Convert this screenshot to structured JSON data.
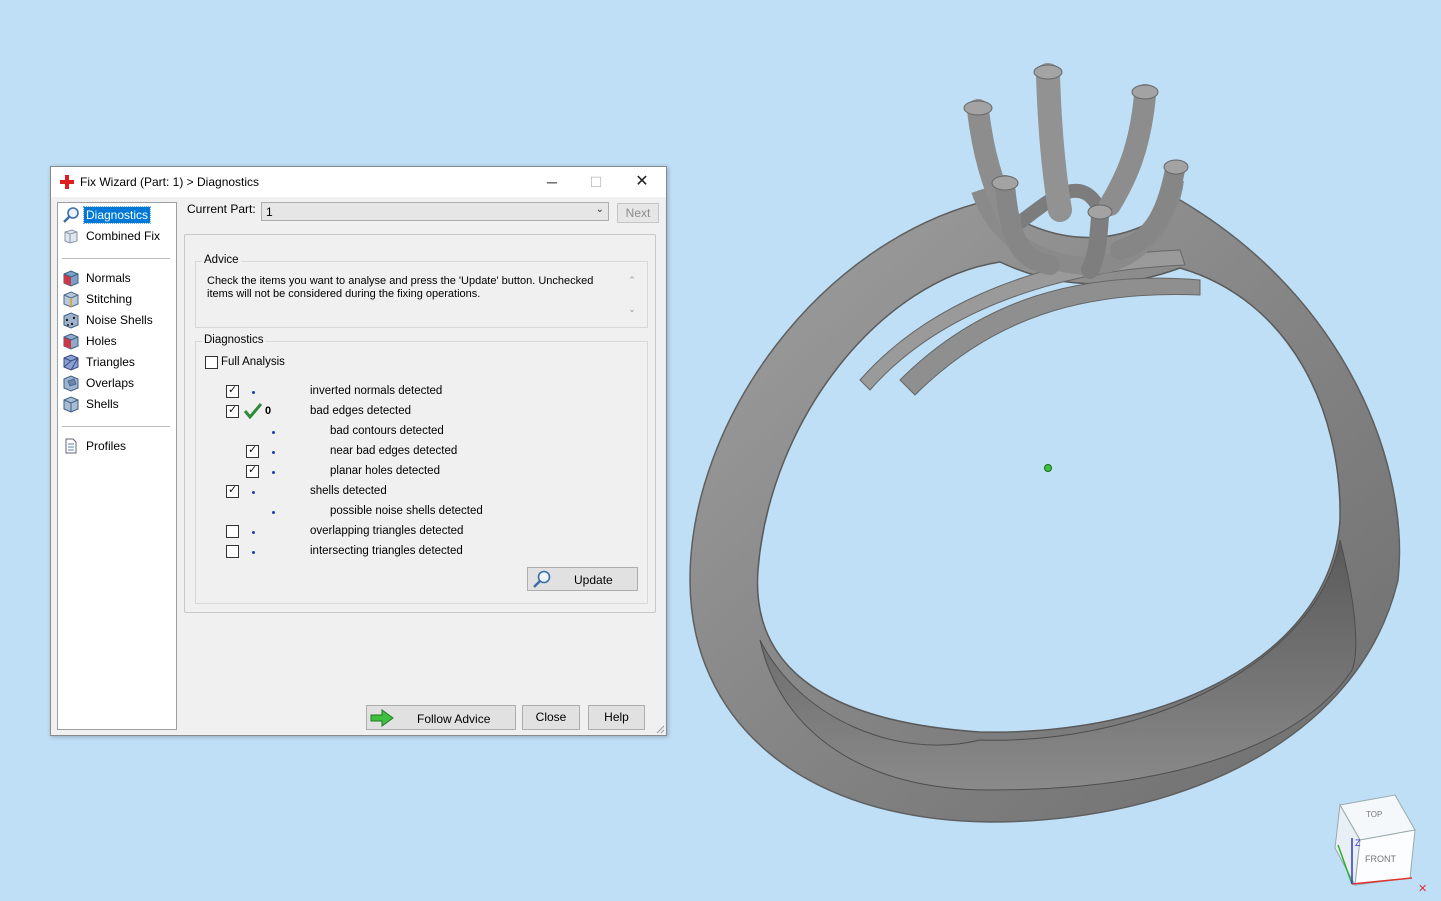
{
  "window": {
    "title": "Fix Wizard (Part: 1) > Diagnostics",
    "minimize_glyph": "─",
    "maximize_glyph": "☐",
    "close_glyph": "✕"
  },
  "sidebar": {
    "items": [
      {
        "label": "Diagnostics",
        "icon": "magnifier-icon",
        "selected": true
      },
      {
        "label": "Combined Fix",
        "icon": "cube-outline-icon"
      },
      {
        "label": "Normals",
        "icon": "normals-cube-icon"
      },
      {
        "label": "Stitching",
        "icon": "stitching-cube-icon"
      },
      {
        "label": "Noise Shells",
        "icon": "noise-shells-icon"
      },
      {
        "label": "Holes",
        "icon": "holes-cube-icon"
      },
      {
        "label": "Triangles",
        "icon": "triangles-cube-icon"
      },
      {
        "label": "Overlaps",
        "icon": "overlaps-cube-icon"
      },
      {
        "label": "Shells",
        "icon": "shells-cube-icon"
      },
      {
        "label": "Profiles",
        "icon": "document-icon"
      }
    ]
  },
  "current_part": {
    "label": "Current Part:",
    "value": "1",
    "next_label": "Next"
  },
  "advice": {
    "title": "Advice",
    "text": "Check the items you want to analyse and press the 'Update' button. Unchecked items will not be considered during the fixing operations."
  },
  "diagnostics": {
    "title": "Diagnostics",
    "full_analysis_label": "Full Analysis",
    "full_analysis_checked": false,
    "rows": [
      {
        "label": "inverted normals detected",
        "checked": true,
        "indent": 0
      },
      {
        "label": "bad edges detected",
        "checked": true,
        "indent": 0,
        "status": "ok",
        "count": "0"
      },
      {
        "label": "bad contours detected",
        "checked": null,
        "indent": 1
      },
      {
        "label": "near bad edges detected",
        "checked": true,
        "indent": 1
      },
      {
        "label": "planar holes detected",
        "checked": true,
        "indent": 1
      },
      {
        "label": "shells detected",
        "checked": true,
        "indent": 0
      },
      {
        "label": "possible noise shells detected",
        "checked": null,
        "indent": 1
      },
      {
        "label": "overlapping triangles detected",
        "checked": false,
        "indent": 0
      },
      {
        "label": "intersecting triangles detected",
        "checked": false,
        "indent": 0
      }
    ],
    "update_label": "Update"
  },
  "buttons": {
    "follow_advice": "Follow Advice",
    "close": "Close",
    "help": "Help"
  },
  "viewport": {
    "background": "#bfdff6",
    "model_color": "#8a8a8a",
    "nav_cube": {
      "top": "TOP",
      "front": "FRONT",
      "z_axis": "Z"
    }
  }
}
